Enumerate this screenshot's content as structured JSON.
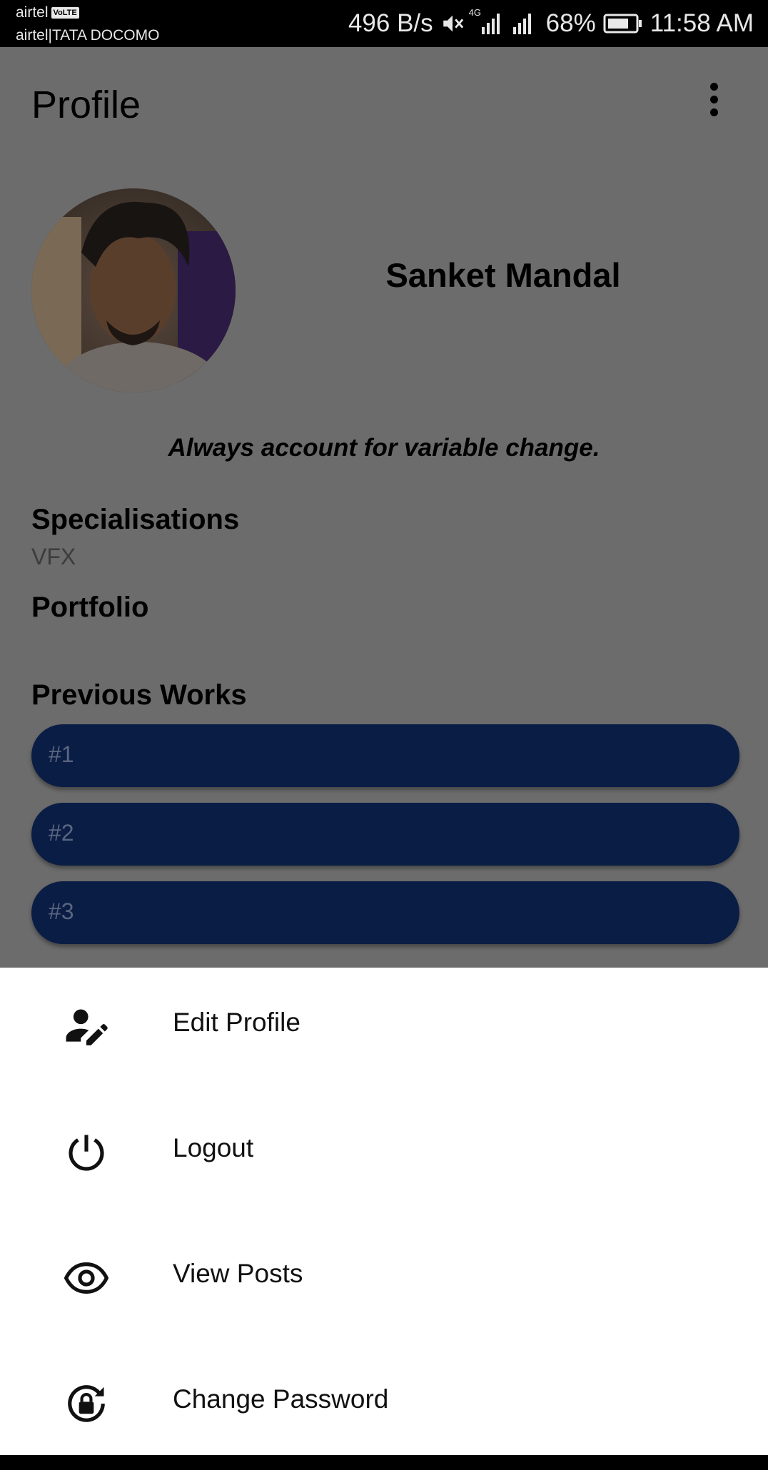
{
  "status_bar": {
    "carrier_primary": "airtel",
    "volte_badge": "VoLTE",
    "carrier_secondary": "airtel|TATA DOCOMO",
    "network_speed": "496 B/s",
    "network_type": "4G",
    "battery_percent": "68%",
    "time": "11:58 AM",
    "icons": [
      "mute-icon",
      "signal-icon",
      "battery-icon"
    ]
  },
  "header": {
    "title": "Profile",
    "menu_icon": "more-vert-icon"
  },
  "profile": {
    "name": "Sanket Mandal",
    "bio": "Always account for variable change.",
    "specialisations_heading": "Specialisations",
    "specialisations_value": "VFX",
    "portfolio_heading": "Portfolio",
    "previous_works_heading": "Previous Works",
    "previous_works": [
      "#1",
      "#2",
      "#3"
    ]
  },
  "bottom_sheet": {
    "items": [
      {
        "label": "Edit Profile",
        "icon": "edit-person-icon"
      },
      {
        "label": "Logout",
        "icon": "power-icon"
      },
      {
        "label": "View Posts",
        "icon": "eye-icon"
      },
      {
        "label": "Change Password",
        "icon": "lock-reset-icon"
      }
    ]
  },
  "colors": {
    "scrim_background": "#6c6c6c",
    "work_item_bg": "#0a1d45",
    "sheet_bg": "#ffffff"
  }
}
